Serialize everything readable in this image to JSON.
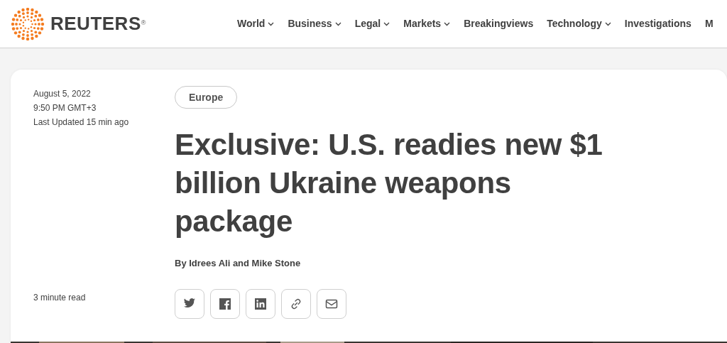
{
  "logo": {
    "wordmark": "REUTERS",
    "mark": "®"
  },
  "nav": [
    {
      "label": "World",
      "dropdown": true
    },
    {
      "label": "Business",
      "dropdown": true
    },
    {
      "label": "Legal",
      "dropdown": true
    },
    {
      "label": "Markets",
      "dropdown": true
    },
    {
      "label": "Breakingviews",
      "dropdown": false
    },
    {
      "label": "Technology",
      "dropdown": true
    },
    {
      "label": "Investigations",
      "dropdown": false
    },
    {
      "label": "M",
      "dropdown": false
    }
  ],
  "article": {
    "date": "August 5, 2022",
    "time": "9:50 PM GMT+3",
    "updated": "Last Updated 15 min ago",
    "read_time": "3 minute read",
    "section": "Europe",
    "headline": "Exclusive: U.S. readies new $1 billion Ukraine weapons package",
    "byline": "By Idrees Ali and Mike Stone",
    "share": [
      {
        "kind": "twitter"
      },
      {
        "kind": "facebook"
      },
      {
        "kind": "linkedin"
      },
      {
        "kind": "link"
      },
      {
        "kind": "email"
      }
    ]
  }
}
